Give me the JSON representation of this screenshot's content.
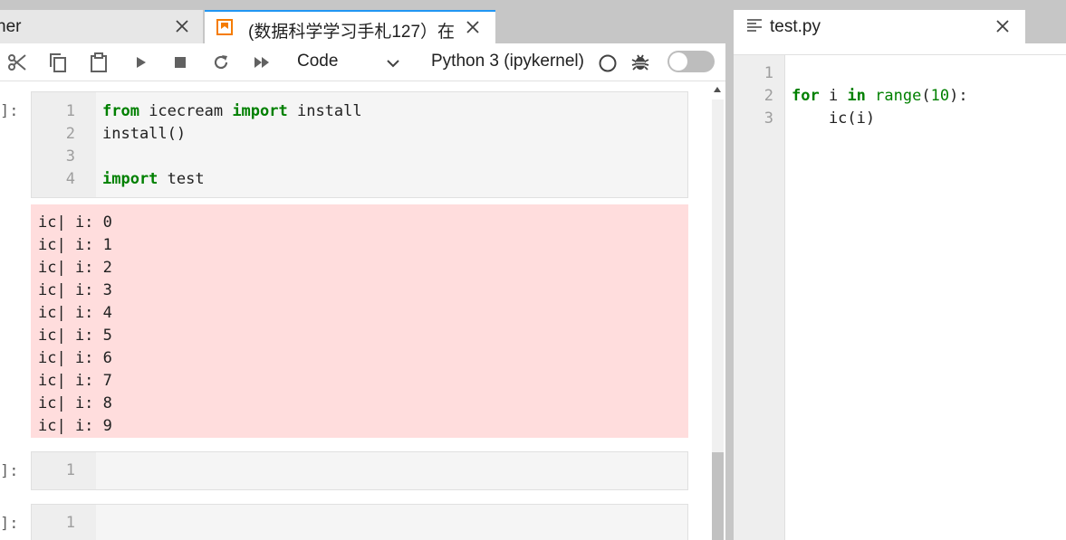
{
  "tabs": {
    "prev_label": "ner",
    "active_label": "(数据科学学习手札127）在"
  },
  "toolbar": {
    "cell_type": "Code",
    "kernel_name": "Python 3 (ipykernel)"
  },
  "notebook": {
    "cells": [
      {
        "prompt": "]:",
        "line_numbers": [
          "1",
          "2",
          "3",
          "4"
        ]
      },
      {
        "prompt": "]:",
        "line_numbers": [
          "1"
        ]
      },
      {
        "prompt": "]:",
        "line_numbers": [
          "1"
        ]
      }
    ],
    "code": {
      "l1_kw1": "from",
      "l1_mod": " icecream ",
      "l1_kw2": "import",
      "l1_name": " install",
      "l2": "install()",
      "l4_kw": "import",
      "l4_mod": " test"
    },
    "output_lines": [
      "ic| i: 0",
      "ic| i: 1",
      "ic| i: 2",
      "ic| i: 3",
      "ic| i: 4",
      "ic| i: 5",
      "ic| i: 6",
      "ic| i: 7",
      "ic| i: 8",
      "ic| i: 9"
    ]
  },
  "editor": {
    "tab_label": "test.py",
    "line_numbers": [
      "1",
      "2",
      "3"
    ],
    "code": {
      "l2_kw1": "for",
      "l2_var": " i ",
      "l2_kw2": "in",
      "l2_sp": " ",
      "l2_fn": "range",
      "l2_open": "(",
      "l2_num": "10",
      "l2_close": "):",
      "l3": "    ic(i)"
    }
  },
  "colors": {
    "accent": "#2196f3",
    "keyword": "#008000",
    "error_output_bg": "#ffdddd",
    "notebook_icon": "#f57c00"
  },
  "icons": {
    "toolbar": [
      "scissors-icon",
      "copy-icon",
      "paste-icon",
      "run-icon",
      "stop-icon",
      "restart-icon",
      "fast-forward-icon"
    ]
  }
}
